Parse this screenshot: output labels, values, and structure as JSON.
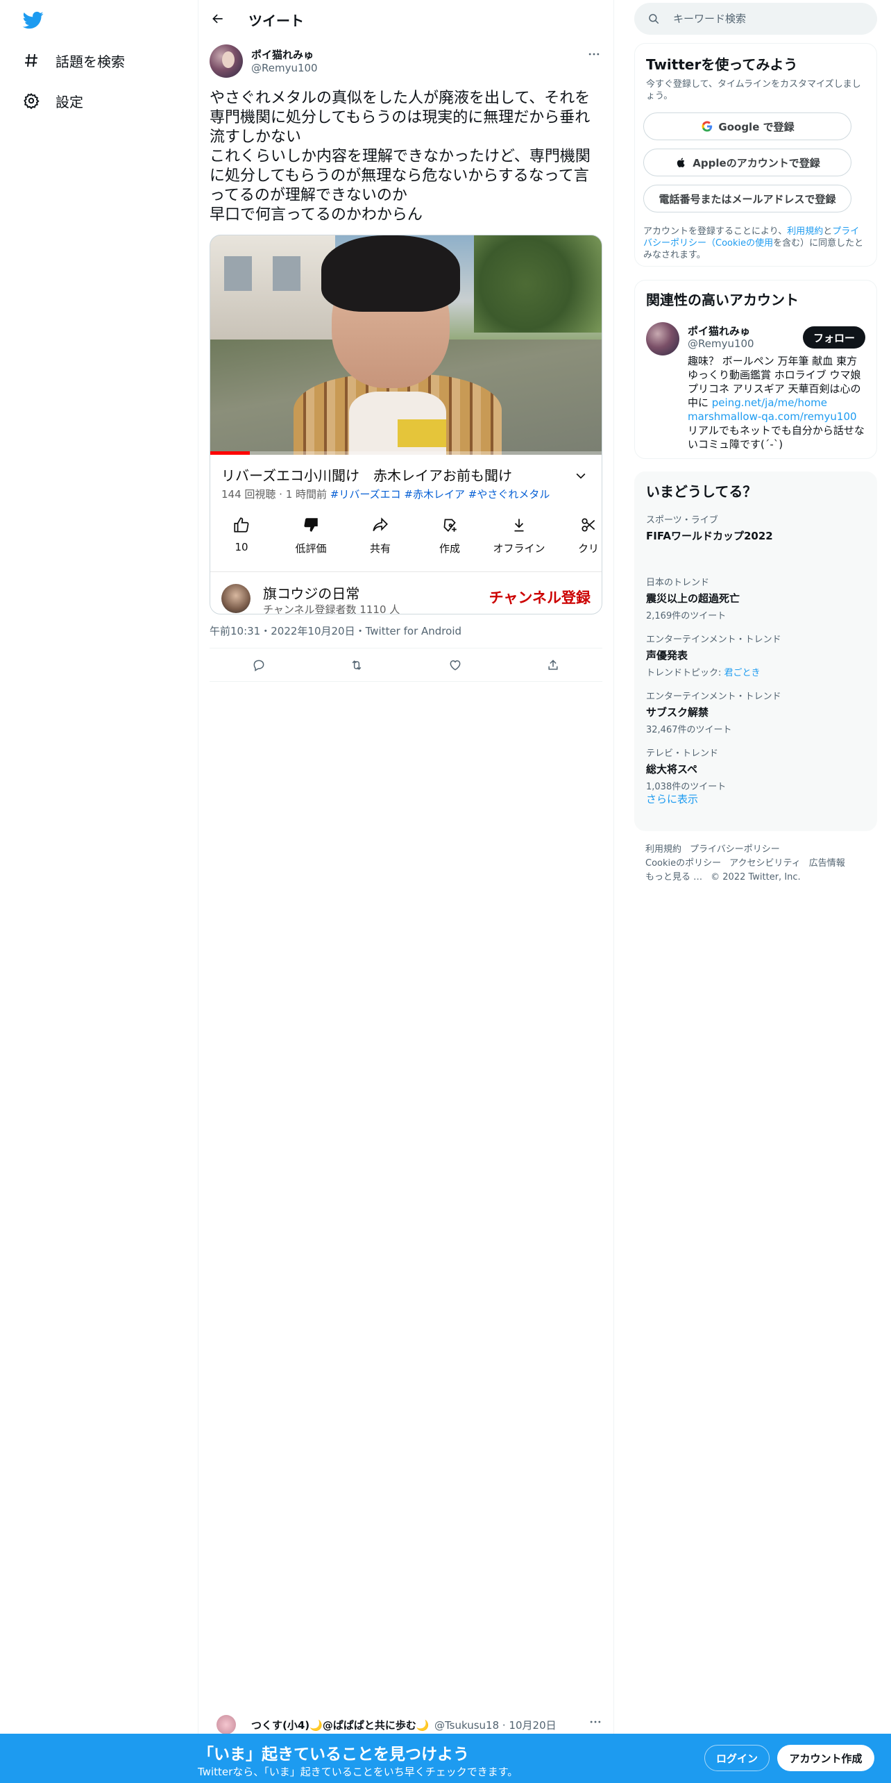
{
  "nav": {
    "items": [
      {
        "label": "話題を検索",
        "icon": "hashtag-icon"
      },
      {
        "label": "設定",
        "icon": "gear-icon"
      }
    ]
  },
  "header": {
    "title": "ツイート"
  },
  "tweet": {
    "author_name": "ポイ猫れみゅ",
    "author_handle": "@Remyu100",
    "text": "やさぐれメタルの真似をした人が廃液を出して、それを専門機関に処分してもらうのは現実的に無理だから垂れ流すしかない\nこれくらいしか内容を理解できなかったけど、専門機関に処分してもらうのが無理なら危ないからするなって言ってるのが理解できないのか\n早口で何言ってるのかわからん",
    "timestamp": "午前10:31・2022年10月20日・Twitter for Android",
    "video": {
      "title": "リバーズエコ小川聞け　赤木レイアお前も聞け",
      "meta": "144 回視聴 · 1 時間前",
      "tags": [
        "#リバーズエコ",
        "#赤木レイア",
        "#やさぐれメタル"
      ],
      "progress_fraction": 0.1,
      "actions": [
        {
          "label": "10",
          "icon": "thumbs-up-icon"
        },
        {
          "label": "低評価",
          "icon": "thumbs-down-icon"
        },
        {
          "label": "共有",
          "icon": "share-icon"
        },
        {
          "label": "作成",
          "icon": "create-icon"
        },
        {
          "label": "オフライン",
          "icon": "download-icon"
        },
        {
          "label": "クリ",
          "icon": "clip-icon"
        }
      ],
      "channel": {
        "name": "旗コウジの日常",
        "subs": "チャンネル登録者数 1110 人",
        "subscribe_label": "チャンネル登録"
      }
    }
  },
  "next_reply": {
    "name": "つくす(小4)🌙@ぱぱぱと共に歩む🌙",
    "handle": "@Tsukusu18 · 10月20日"
  },
  "sidebar": {
    "search_placeholder": "キーワード検索",
    "signup": {
      "title": "Twitterを使ってみよう",
      "subtitle": "今すぐ登録して、タイムラインをカスタマイズしましょう。",
      "google": "Google で登録",
      "apple": "Appleのアカウントで登録",
      "phone": "電話番号またはメールアドレスで登録",
      "legal_prefix": "アカウントを登録することにより、",
      "legal_terms": "利用規約",
      "legal_and": "と",
      "legal_privacy": "プライバシーポリシー",
      "legal_cookie": "（Cookieの使用",
      "legal_suffix": "を含む）に同意したとみなされます。"
    },
    "related": {
      "title": "関連性の高いアカウント",
      "name": "ポイ猫れみゅ",
      "handle": "@Remyu100",
      "follow_label": "フォロー",
      "bio_before": "趣味？ ボールペン 万年筆 献血 東方 ゆっくり動画鑑賞 ホロライブ ウマ娘 プリコネ アリスギア 天華百剣は心の中に ",
      "bio_link1": "peing.net/ja/me/home",
      "bio_link2": "marshmallow-qa.com/remyu100",
      "bio_after": " リアルでもネットでも自分から話せないコミュ障です(´-`)"
    },
    "trends": {
      "title": "いまどうしてる？",
      "items": [
        {
          "category": "スポーツ・ライブ",
          "name": "FIFAワールドカップ2022",
          "count": ""
        },
        {
          "category": "日本のトレンド",
          "name": "震災以上の超過死亡",
          "count": "2,169件のツイート"
        },
        {
          "category": "エンターテインメント・トレンド",
          "name": "声優発表",
          "count_prefix": "トレンドトピック: ",
          "count_link": "君ごとき"
        },
        {
          "category": "エンターテインメント・トレンド",
          "name": "サブスク解禁",
          "count": "32,467件のツイート"
        },
        {
          "category": "テレビ・トレンド",
          "name": "総大将スペ",
          "count": "1,038件のツイート"
        }
      ],
      "show_more": "さらに表示"
    },
    "footer": {
      "links": [
        "利用規約",
        "プライバシーポリシー",
        "Cookieのポリシー",
        "アクセシビリティ",
        "広告情報",
        "もっと見る …"
      ],
      "copyright": "© 2022 Twitter, Inc."
    }
  },
  "bottom_bar": {
    "title": "「いま」起きていることを見つけよう",
    "subtitle": "Twitterなら、「いま」起きていることをいち早くチェックできます。",
    "login": "ログイン",
    "signup": "アカウント作成"
  },
  "colors": {
    "brand": "#1d9bf0",
    "text": "#0f1419",
    "muted": "#536471",
    "youtube_red": "#cc0000"
  }
}
